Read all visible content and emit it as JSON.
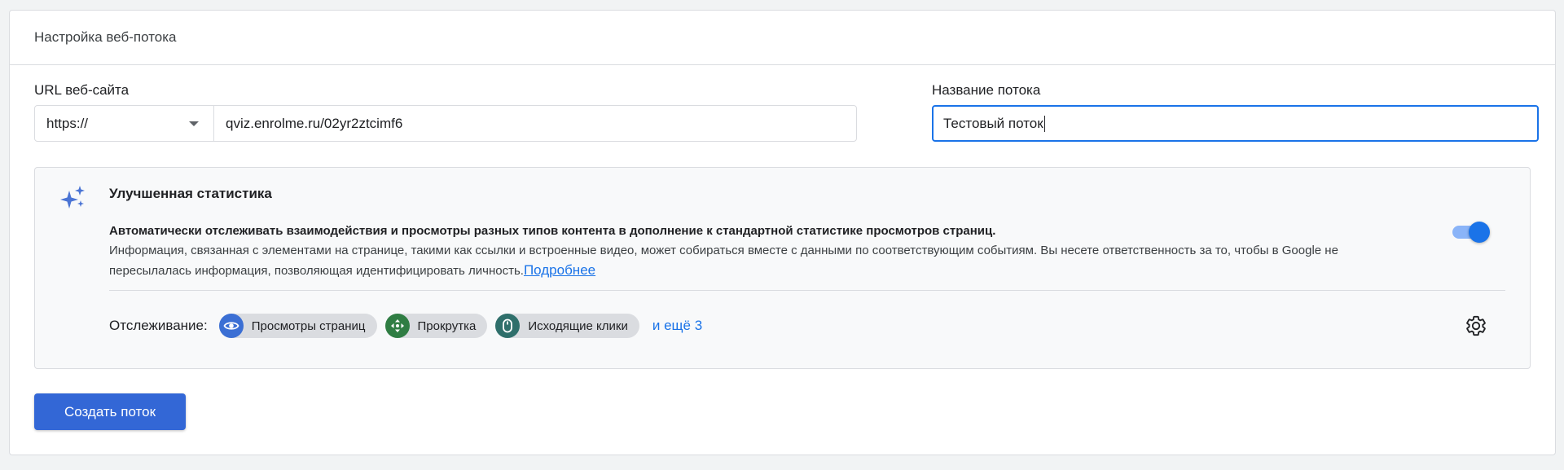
{
  "header": {
    "title": "Настройка веб-потока"
  },
  "url_field": {
    "label": "URL веб-сайта",
    "protocol": "https://",
    "value": "qviz.enrolme.ru/02yr2ztcimf6"
  },
  "name_field": {
    "label": "Название потока",
    "value": "Тестовый поток"
  },
  "enhanced": {
    "title": "Улучшенная статистика",
    "description_bold": "Автоматически отслеживать взаимодействия и просмотры разных типов контента в дополнение к стандартной статистике просмотров страниц.",
    "description": "Информация, связанная с элементами на странице, такими как ссылки и встроенные видео, может собираться вместе с данными по соответствующим событиям. Вы несете ответственность за то, чтобы в Google не пересылалась информация, позволяющая идентифицировать личность.",
    "learn_more": "Подробнее",
    "toggle_on": true,
    "tracking_label": "Отслеживание:",
    "chips": [
      {
        "label": "Просмотры страниц",
        "icon": "eye-icon",
        "color": "#3b6fd4"
      },
      {
        "label": "Прокрутка",
        "icon": "scroll-icon",
        "color": "#2f7d43"
      },
      {
        "label": "Исходящие клики",
        "icon": "mouse-icon",
        "color": "#2f6f6b"
      }
    ],
    "more": "и ещё 3"
  },
  "actions": {
    "create_label": "Создать поток"
  },
  "colors": {
    "accent": "#1a73e8",
    "button": "#3367d6"
  }
}
